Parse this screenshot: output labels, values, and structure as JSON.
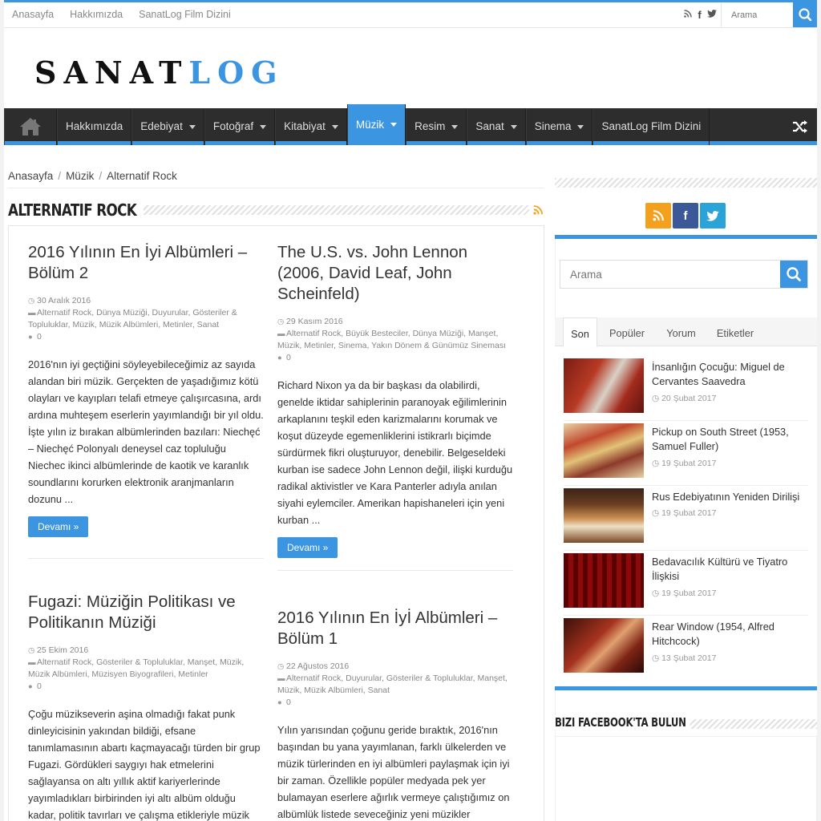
{
  "topbar": {
    "links": [
      "Anasayfa",
      "Hakkımızda",
      "SanatLog Film Dizini"
    ],
    "search_placeholder": "Arama"
  },
  "logo": {
    "part1": "SANAT",
    "part2": "LOG"
  },
  "nav": {
    "items": [
      {
        "label": "Hakkımızda",
        "dropdown": false
      },
      {
        "label": "Edebiyat",
        "dropdown": true
      },
      {
        "label": "Fotoğraf",
        "dropdown": true
      },
      {
        "label": "Kitabiyat",
        "dropdown": true
      },
      {
        "label": "Müzik",
        "dropdown": true,
        "active": true
      },
      {
        "label": "Resim",
        "dropdown": true
      },
      {
        "label": "Sanat",
        "dropdown": true
      },
      {
        "label": "Sinema",
        "dropdown": true
      },
      {
        "label": "SanatLog Film Dizini",
        "dropdown": false
      }
    ]
  },
  "breadcrumb": [
    "Anasayfa",
    "Müzik",
    "Alternatif Rock"
  ],
  "category_title": "ALTERNATIF ROCK",
  "posts": [
    {
      "title": "2016 Yılının En İyi Albümleri – Bölüm 2",
      "date": "30 Aralık 2016",
      "categories": "Alternatif Rock, Dünya Müziği, Duyurular, Gösteriler & Topluluklar, Müzik, Müzik Albümleri, Metinler, Sanat",
      "comments": "0",
      "excerpt": "2016'nın iyi geçtiğini söyleyebileceğimiz az sayıda alandan biri müzik. Gerçekten de yaşadığımız kötü olayları ve kayıpları telafi etmeye çalışırcasına, ardı ardına muhteşem eserlerin yayımlandığı bir yıl oldu. İşte yılın iz bırakan albümlerinden bazıları: Niechęć – Niechęć Polonyalı deneysel caz topluluğu Niechec ikinci albümlerinde de kaotik ve karanlık soundlarını korurken elektronik aranjmanların dozunu ...",
      "more": "Devamı »"
    },
    {
      "title": "The U.S. vs. John Lennon (2006, David Leaf, John Scheinfeld)",
      "date": "29 Kasım 2016",
      "categories": "Alternatif Rock, Büyük Besteciler, Dünya Müziği, Manşet, Müzik, Metinler, Sinema, Yakın Dönem & Günümüz Sineması",
      "comments": "0",
      "excerpt": "Richard Nixon ya da bir başkası da olabilirdi, genelde iktidar sahiplerinin paranoyak eğilimlerinin arkaplanını teşkil eden karizmalarını korumak ve koşut düzeyde egemenliklerini istikrarlı biçimde sürdürmek fikri oluşturuyor, denebilir. Belgeseldeki kurban ise sadece John Lennon değil, ilişki kurduğu radikal aktivistler ve Kara Panterler adıyla anılan siyahi eylemciler. Amerikan hapishaneleri için yeni kurban ...",
      "more": "Devamı »"
    },
    {
      "title": "Fugazi: Müziğin Politikası ve Politikanın Müziği",
      "date": "25 Ekim 2016",
      "categories": "Alternatif Rock, Gösteriler & Topluluklar, Manşet, Müzik, Müzik Albümleri, Müzisyen Biyografileri, Metinler",
      "comments": "0",
      "excerpt": "Çoğu müzikseverin aşina olmadığı fakat punk dinleyicisinin yakından bildiği, efsane tanımlamasının abartı kaçmayacağı türden bir grup Fugazi. Gördükleri saygıyı hak etmelerini sağlayansa on altı yıllık aktif kariyerlerinde yayımladıkları birbirinden iyi altı albüm olduğu kadar, politik tavırları ve çalışma etikleriyle müzik"
    },
    {
      "title": "2016 Yılının En İyİ Albümleri – Bölüm 1",
      "date": "22 Ağustos 2016",
      "categories": "Alternatif Rock, Duyurular, Gösteriler & Topluluklar, Manşet, Müzik, Müzik Albümleri, Sanat",
      "comments": "0",
      "excerpt": "Yılın yarısından çoğunu geride bıraktık, 2016'nın başından bu yana yayımlanan, farklı ülkelerden ve müzik türlerinden en iyi albümleri paylaşmak için iyi bir zaman. Özellikle popüler medyada pek yer bulamayan eserlere ağırlık vermeye çalıştığımız on albümlük listede seveceğiniz yeni müzikler"
    }
  ],
  "sidebar": {
    "search_placeholder": "Arama",
    "tabs": [
      "Son",
      "Popüler",
      "Yorum",
      "Etiketler"
    ],
    "recent": [
      {
        "title": "İnsanlığın Çocuğu: Miguel de Cervantes Saavedra",
        "date": "20 Şubat 2017"
      },
      {
        "title": "Pickup on South Street (1953, Samuel Fuller)",
        "date": "19 Şubat 2017"
      },
      {
        "title": "Rus Edebiyatının Yeniden Dirilişi",
        "date": "19 Şubat 2017"
      },
      {
        "title": "Bedavacılık Kültürü ve Tiyatro İlişkisi",
        "date": "19 Şubat 2017"
      },
      {
        "title": "Rear Window (1954, Alfred Hitchcock)",
        "date": "13 Şubat 2017"
      }
    ],
    "facebook_title": "BIZI FACEBOOK'TA BULUN"
  },
  "colors": {
    "accent": "#3b95e0",
    "nav_bg": "#2d2d2d",
    "rss": "#f4a01c",
    "facebook": "#3b5998",
    "twitter": "#2aa3d9"
  }
}
